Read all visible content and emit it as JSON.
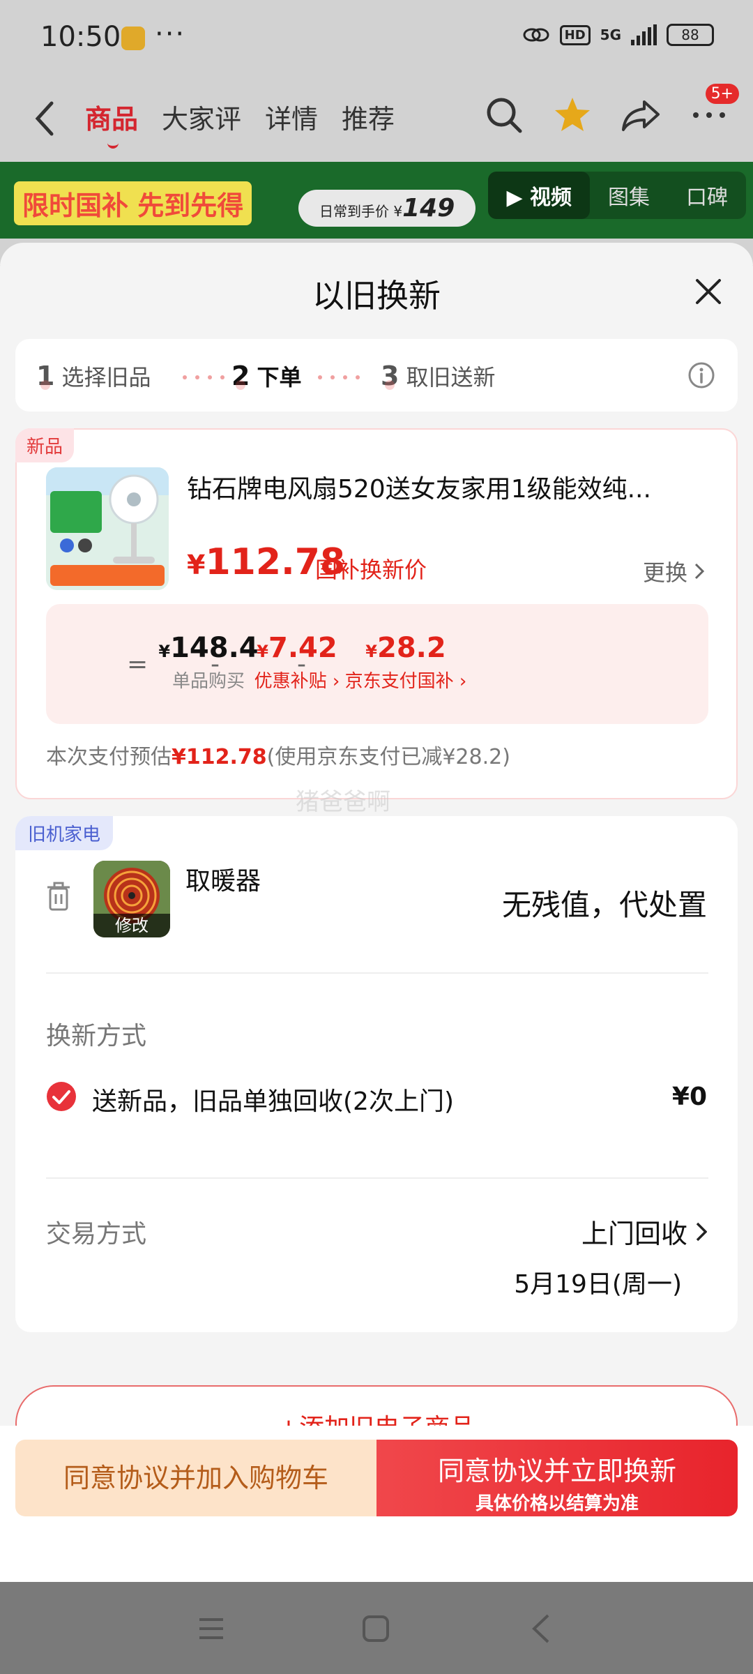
{
  "status_bar": {
    "time": "10:50",
    "dots": "···",
    "network": "5G",
    "hd": "HD",
    "battery": "88"
  },
  "nav": {
    "tabs": [
      "商品",
      "大家评",
      "详情",
      "推荐"
    ],
    "active_tab": "商品",
    "badge": "5+"
  },
  "banner": {
    "promo_text": "限时国补 先到先得",
    "price_prefix": "日常到手价 ¥",
    "price": "149",
    "media_tabs": [
      "视频",
      "图集",
      "口碑"
    ],
    "active_media": "视频"
  },
  "sheet": {
    "title": "以旧换新",
    "steps": [
      {
        "num": "1",
        "label": "选择旧品"
      },
      {
        "num": "2",
        "label": "下单"
      },
      {
        "num": "3",
        "label": "取旧送新"
      }
    ],
    "active_step": "2"
  },
  "new_item": {
    "tag": "新品",
    "title": "钻石牌电风扇520送女友家用1级能效纯...",
    "price_symbol": "¥",
    "price": "112.78",
    "price_label": "国补换新价",
    "change_label": "更换",
    "breakdown": {
      "eq": "=",
      "minus": "-",
      "base_value": "148.4",
      "base_label": "单品购买",
      "discount_value": "7.42",
      "discount_label": "优惠补贴",
      "subsidy_value": "28.2",
      "subsidy_label": "京东支付国补"
    },
    "pay_note_prefix": "本次支付预估",
    "pay_note_amount": "¥112.78",
    "pay_note_suffix": "(使用京东支付已减¥28.2)"
  },
  "watermark": "猪爸爸啊",
  "old_item": {
    "tag": "旧机家电",
    "name": "取暖器",
    "edit_label": "修改",
    "value_text": "无残值，代处置",
    "method_title": "换新方式",
    "method_text": "送新品，旧品单独回收(2次上门)",
    "method_price": "¥0",
    "trade_title": "交易方式",
    "trade_value": "上门回收",
    "trade_date": "5月19日(周一)"
  },
  "add_old_label": "+添加旧电子商品",
  "footer": {
    "cart_label": "同意协议并加入购物车",
    "swap_label": "同意协议并立即换新",
    "swap_sub": "具体价格以结算为准"
  },
  "colors": {
    "accent": "#e2231a",
    "cart_bg": "#fde3c9",
    "old_tag": "#4a5fd0"
  }
}
